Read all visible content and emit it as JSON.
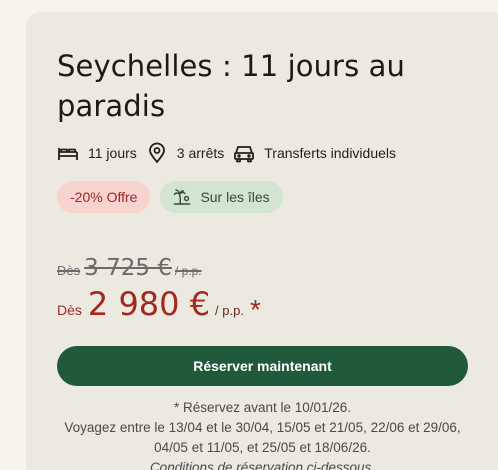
{
  "title": "Seychelles : 11 jours au paradis",
  "features": [
    {
      "icon": "bed-icon",
      "label": "11 jours"
    },
    {
      "icon": "location-pin-icon",
      "label": "3 arrêts"
    },
    {
      "icon": "car-icon",
      "label": "Transferts individuels"
    }
  ],
  "badges": {
    "offer": "-20% Offre",
    "theme": "Sur les îles",
    "theme_icon": "palm-island-icon"
  },
  "price": {
    "old_prefix": "Dès",
    "old_amount": "3 725 €",
    "old_per": "/ p.p.",
    "new_prefix": "Dès",
    "new_amount": "2 980 €",
    "new_per": "/ p.p.",
    "asterisk": "*"
  },
  "cta": "Réserver maintenant",
  "notes": {
    "line1": "* Réservez avant le 10/01/26.",
    "line2": "Voyagez entre le 13/04 et le 30/04, 15/05 et 21/05, 22/06 et 29/06, 04/05 et 11/05, et 25/05 et 18/06/26.",
    "line3": "Conditions de réservation ci-dessous."
  },
  "colors": {
    "page_bg": "#f7f4ec",
    "card_bg": "#ebe9e0",
    "accent_green": "#205a3a",
    "price_red": "#a12a20",
    "offer_badge_bg": "#f6d3cf",
    "theme_badge_bg": "#d3e5d2"
  }
}
